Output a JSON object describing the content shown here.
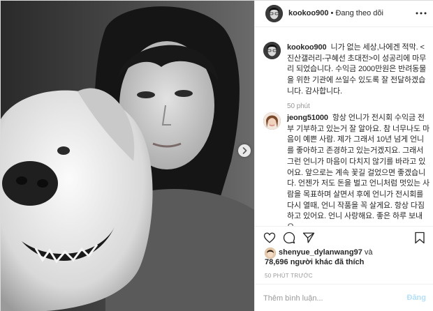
{
  "header": {
    "username": "kookoo900",
    "separator": " • ",
    "follow_status": "Đang theo dõi"
  },
  "caption": {
    "username": "kookoo900",
    "text": "니가 없는 세상,나에겐 적막. <진산갤러리-구혜선 초대전>이 성공리에 마무리 되었습니다. 수익금 2000만원은 반려동물을 위한 기관에 쓰일수 있도록 잘 전달하겠습니다. 감사합니다.",
    "time": "50 phút"
  },
  "comments": [
    {
      "username": "jeong51000",
      "text": "항상 언니가 전시회 수익금 전부 기부하고 있는거 잘 알아요. 참 너무나도 마음이 예쁜 사람. 제가 그래서 10년 넘게 언니를 좋아하고 존경하고 있는거겠지요. 그래서 그런 언니가 마음이 다치지 않기를 바라고 있어요. 앞으로는 계속 꽃길 걸었으면 좋겠습니다. 언젠가 저도 돈을 벌고 언니처럼 멋있는 사람을 목표하며 살면서 후에 언니가 전시회를 다시 열때, 언니 작품을 꼭 살게요. 항상 다짐하고 있어요. 언니 사랑해요. 좋은 하루 보내요."
    }
  ],
  "likes": {
    "first_user": "shenyue_dylanwang97",
    "and_label": " và",
    "count": "78,696",
    "others_label": " người khác đã thích"
  },
  "timestamp": "50 PHÚT TRƯỚC",
  "add_comment": {
    "placeholder": "Thêm bình luận...",
    "post_label": "Đăng"
  },
  "icons": {
    "more": "more-horizontal-icon",
    "like": "heart-icon",
    "comment": "comment-icon",
    "share": "share-icon",
    "save": "bookmark-icon",
    "carousel_next": "chevron-right-icon"
  },
  "colors": {
    "accent": "#3897f0",
    "post_disabled": "#b2dffc",
    "border": "#efefef",
    "muted": "#999999"
  }
}
